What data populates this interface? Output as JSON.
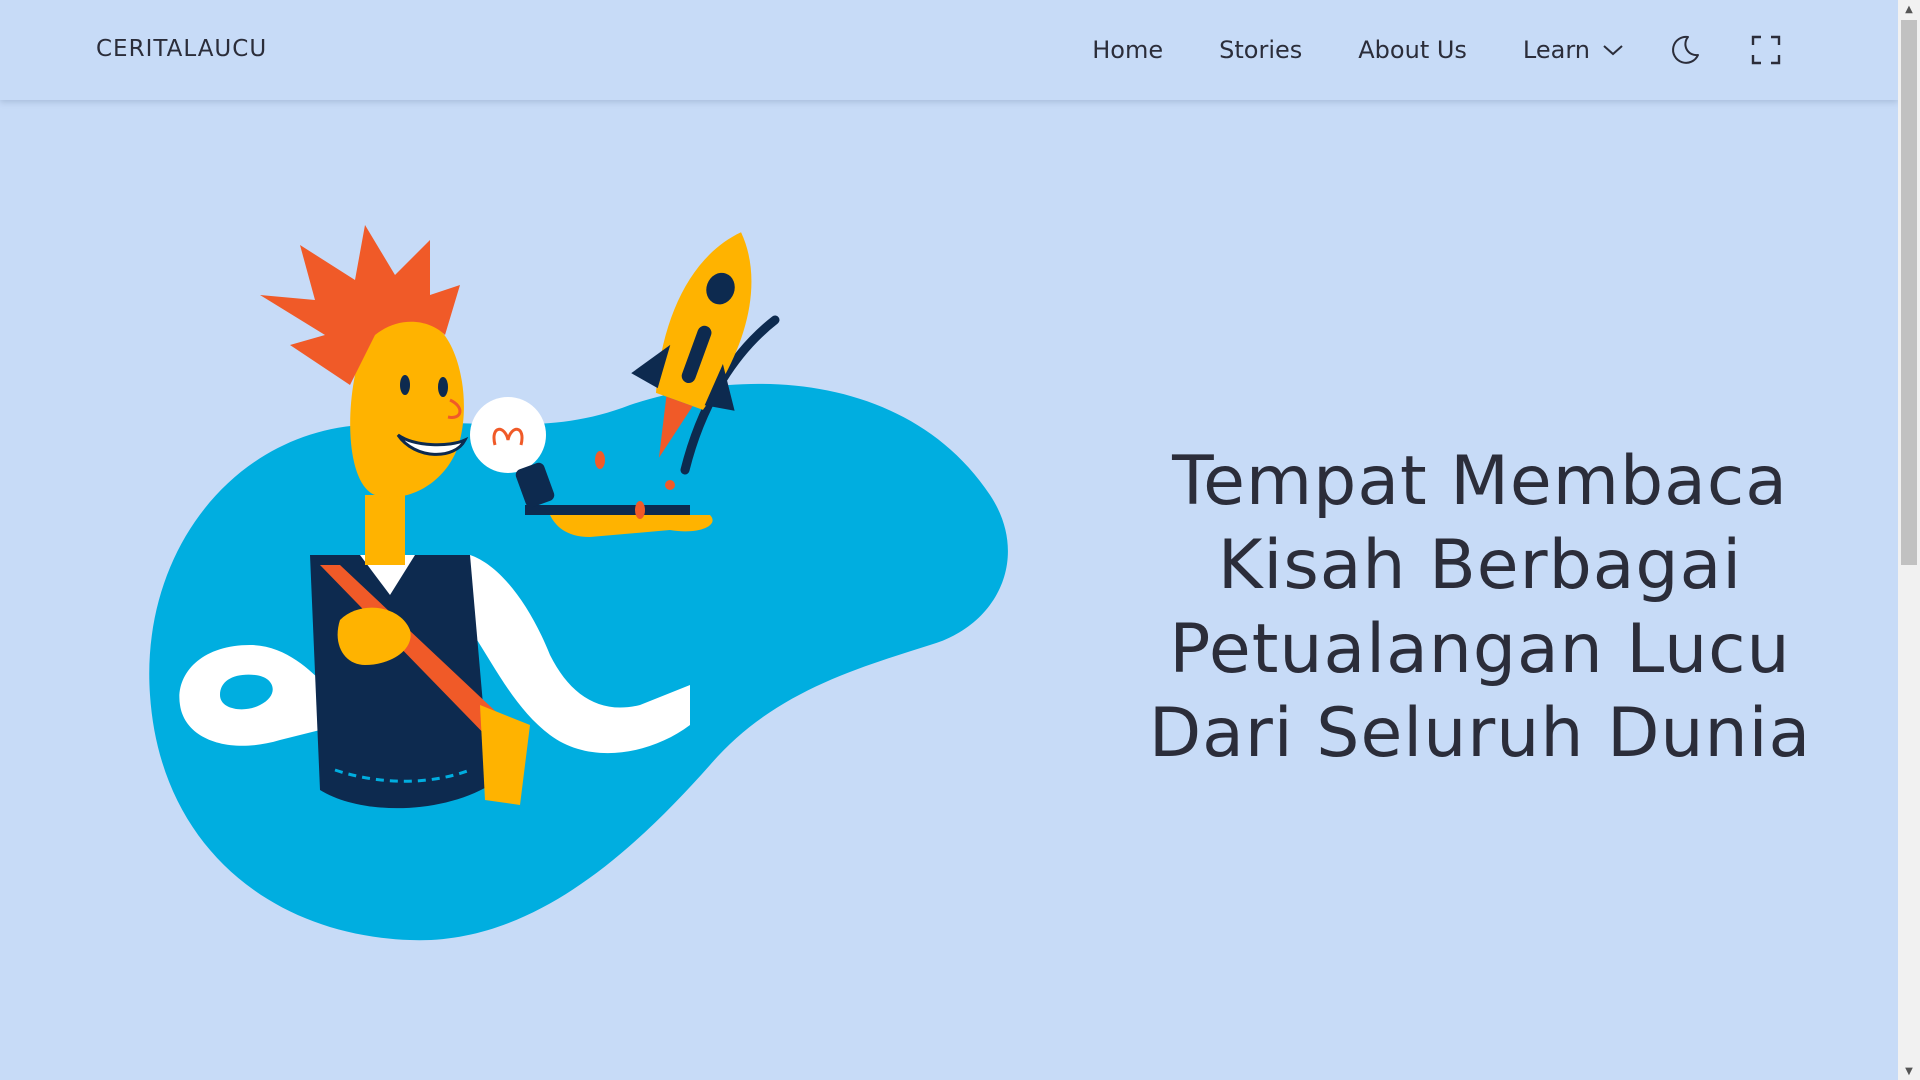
{
  "brand": "CERITALAUCU",
  "nav": {
    "home": "Home",
    "stories": "Stories",
    "about": "About Us",
    "learn": "Learn"
  },
  "icons": {
    "dropdown": "chevron-down-icon",
    "theme_toggle": "moon-icon",
    "fullscreen": "fullscreen-icon"
  },
  "hero": {
    "line1": "Tempat Membaca",
    "line2": "Kisah Berbagai",
    "line3": "Petualangan Lucu",
    "line4": "Dari Seluruh Dunia"
  },
  "colors": {
    "background": "#c7dbf7",
    "text": "#2b2d3a",
    "blob": "#00aee0",
    "hair": "#f05a28",
    "skin": "#ffb300",
    "vest": "#0d2a4f"
  }
}
